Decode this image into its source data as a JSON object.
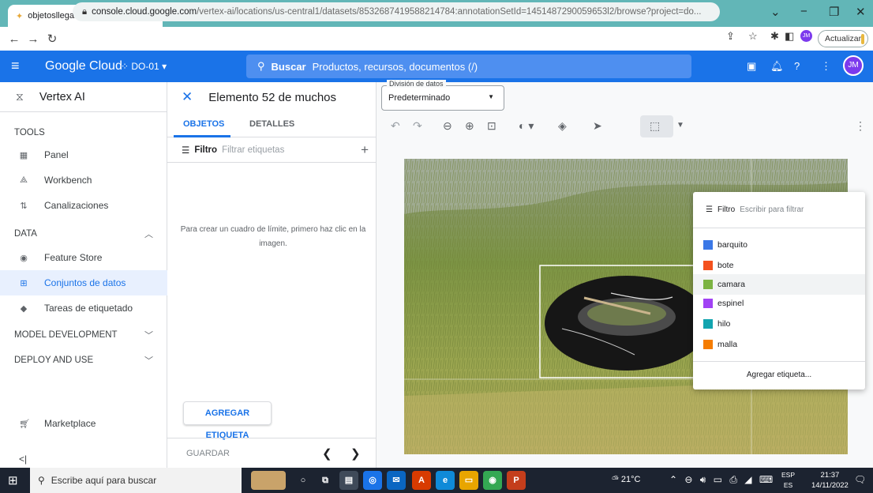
{
  "browser": {
    "tab_title": "objetosllegales – Vertex AI – DO-",
    "url_host": "console.cloud.google.com",
    "url_rest": "/vertex-ai/locations/us-central1/datasets/8532687419588214784:annotationSetId=1451487290059653l2/browse?project=do...",
    "update_label": "Actualizar",
    "avatar_initials": "JM"
  },
  "gcp": {
    "logo_text": "Google Cloud",
    "project": "DO-01",
    "search_bold": "Buscar",
    "search_placeholder": "Productos, recursos, documentos (/)",
    "avatar_initials": "JM"
  },
  "leftnav": {
    "title": "Vertex AI",
    "sections": {
      "tools": "TOOLS",
      "data": "DATA",
      "model_dev": "MODEL DEVELOPMENT",
      "deploy": "DEPLOY AND USE"
    },
    "items": [
      {
        "label": "Panel"
      },
      {
        "label": "Workbench"
      },
      {
        "label": "Canalizaciones"
      },
      {
        "label": "Feature Store"
      },
      {
        "label": "Conjuntos de datos"
      },
      {
        "label": "Tareas de etiquetado"
      },
      {
        "label": "Marketplace"
      }
    ],
    "collapse": "<|"
  },
  "mid": {
    "title": "Elemento 52 de muchos",
    "tab_objetos": "OBJETOS",
    "tab_detalles": "DETALLES",
    "filter_label": "Filtro",
    "filter_placeholder": "Filtrar etiquetas",
    "hint": "Para crear un cuadro de límite, primero haz clic en la imagen.",
    "add_label_button": "AGREGAR ETIQUETA",
    "save_button": "GUARDAR"
  },
  "canvas": {
    "split_label": "División de datos",
    "split_value": "Predeterminado"
  },
  "labelmenu": {
    "filter_label": "Filtro",
    "filter_placeholder": "Escribir para filtrar",
    "labels": [
      {
        "name": "barquito",
        "color": "#3b78e7"
      },
      {
        "name": "bote",
        "color": "#f4511e"
      },
      {
        "name": "camara",
        "color": "#7cb342"
      },
      {
        "name": "espinel",
        "color": "#a142f4"
      },
      {
        "name": "hilo",
        "color": "#12a4af"
      },
      {
        "name": "malla",
        "color": "#f57c00"
      }
    ],
    "highlighted_label": "camara",
    "add_label": "Agregar etiqueta..."
  },
  "taskbar": {
    "search_placeholder": "Escribe aquí para buscar",
    "weather": "21°C",
    "lang_top": "ESP",
    "lang_bottom": "ES",
    "time": "21:37",
    "date": "14/11/2022"
  }
}
